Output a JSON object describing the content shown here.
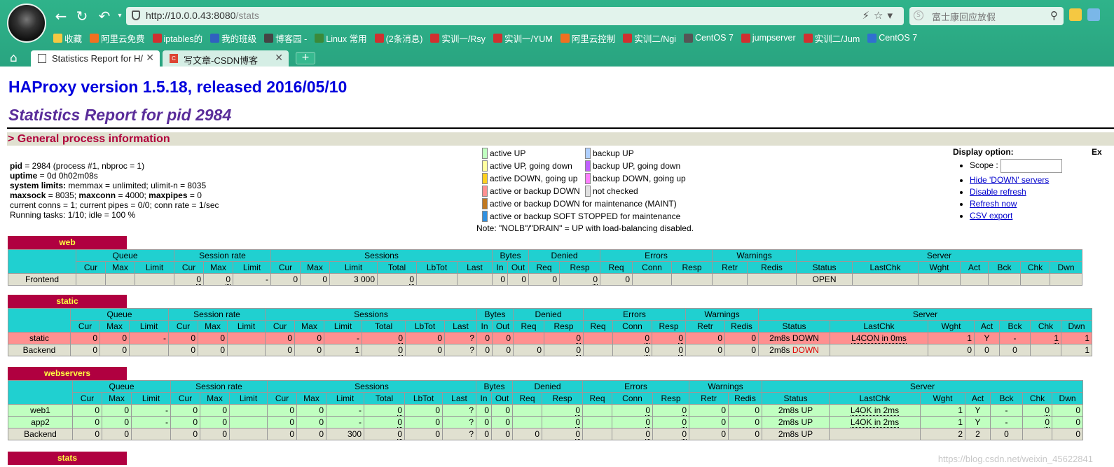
{
  "browser": {
    "url_host": "http://10.0.0.43:8080",
    "url_path": "/stats",
    "search_placeholder": "富士康回应放假",
    "bookmarks": [
      "收藏",
      "阿里云免费",
      "iptables的",
      "我的班级",
      "博客园 -",
      "Linux 常用",
      "(2条消息)",
      "实训一/Rsy",
      "实训一/YUM",
      "阿里云控制",
      "实训二/Ngi",
      "CentOS 7",
      "jumpserver",
      "实训二/Jum",
      "CentOS 7"
    ],
    "tabs": [
      {
        "label": "Statistics Report for H/",
        "active": true
      },
      {
        "label": "写文章-CSDN博客",
        "active": false
      }
    ]
  },
  "page": {
    "title": "HAProxy version 1.5.18, released 2016/05/10",
    "subtitle": "Statistics Report for pid 2984",
    "section": "> General process information",
    "info": {
      "pid_label": "pid",
      "pid_value": " = 2984 (process #1, nbproc = 1)",
      "uptime_label": "uptime",
      "uptime_value": " = 0d 0h02m08s",
      "limits_label": "system limits:",
      "limits_value": " memmax = unlimited; ulimit-n = 8035",
      "maxsock_label": "maxsock",
      "maxsock_value": " = 8035; ",
      "maxconn_label": "maxconn",
      "maxconn_value": " = 4000; ",
      "maxpipes_label": "maxpipes",
      "maxpipes_value": " = 0",
      "conns": "current conns = 1; current pipes = 0/0; conn rate = 1/sec",
      "tasks": "Running tasks: 1/10; idle = 100 %"
    },
    "legend": {
      "active_up": "active UP",
      "active_up_going_down": "active UP, going down",
      "active_down_going_up": "active DOWN, going up",
      "active_or_backup_down": "active or backup DOWN",
      "maint": "active or backup DOWN for maintenance (MAINT)",
      "soft_stopped": "active or backup SOFT STOPPED for maintenance",
      "backup_up": "backup UP",
      "backup_up_going_down": "backup UP, going down",
      "backup_down_going_up": "backup DOWN, going up",
      "not_checked": "not checked",
      "note": "Note: \"NOLB\"/\"DRAIN\" = UP with load-balancing disabled."
    },
    "display": {
      "title": "Display option:",
      "scope": "Scope :",
      "hide_down": "Hide 'DOWN' servers",
      "disable_refresh": "Disable refresh",
      "refresh_now": "Refresh now",
      "csv_export": "CSV export",
      "ex": "Ex"
    },
    "watermark": "https://blog.csdn.net/weixin_45622841"
  },
  "headers": {
    "groups": [
      "Queue",
      "Session rate",
      "Sessions",
      "Bytes",
      "Denied",
      "Errors",
      "Warnings",
      "Server"
    ],
    "cols": [
      "Cur",
      "Max",
      "Limit",
      "Cur",
      "Max",
      "Limit",
      "Cur",
      "Max",
      "Limit",
      "Total",
      "LbTot",
      "Last",
      "In",
      "Out",
      "Req",
      "Resp",
      "Req",
      "Conn",
      "Resp",
      "Retr",
      "Redis",
      "Status",
      "LastChk",
      "Wght",
      "Act",
      "Bck",
      "Chk",
      "Dwn"
    ]
  },
  "proxies": [
    {
      "name": "web",
      "rows": [
        {
          "cls": "frontend",
          "cells": [
            "Frontend",
            "",
            "",
            "",
            "0",
            "0",
            "-",
            "0",
            "0",
            "3 000",
            "0",
            "",
            "",
            "0",
            "0",
            "0",
            "0",
            "0",
            "",
            "",
            "",
            "",
            "OPEN",
            "",
            "",
            "",
            "",
            "",
            ""
          ]
        }
      ]
    },
    {
      "name": "static",
      "rows": [
        {
          "cls": "down",
          "cells": [
            "static",
            "0",
            "0",
            "-",
            "0",
            "0",
            "",
            "0",
            "0",
            "-",
            "0",
            "0",
            "?",
            "0",
            "0",
            "",
            "0",
            "",
            "0",
            "0",
            "0",
            "0",
            "2m8s DOWN",
            "L4CON in 0ms",
            "1",
            "Y",
            "-",
            "1",
            "1"
          ]
        },
        {
          "cls": "backend",
          "cells": [
            "Backend",
            "0",
            "0",
            "",
            "0",
            "0",
            "",
            "0",
            "0",
            "1",
            "0",
            "0",
            "?",
            "0",
            "0",
            "0",
            "0",
            "",
            "0",
            "0",
            "0",
            "0",
            "2m8s DOWN",
            "",
            "0",
            "0",
            "0",
            "",
            "1"
          ]
        }
      ]
    },
    {
      "name": "webservers",
      "rows": [
        {
          "cls": "up",
          "cells": [
            "web1",
            "0",
            "0",
            "-",
            "0",
            "0",
            "",
            "0",
            "0",
            "-",
            "0",
            "0",
            "?",
            "0",
            "0",
            "",
            "0",
            "",
            "0",
            "0",
            "0",
            "0",
            "2m8s UP",
            "L4OK in 2ms",
            "1",
            "Y",
            "-",
            "0",
            "0"
          ]
        },
        {
          "cls": "up",
          "cells": [
            "app2",
            "0",
            "0",
            "-",
            "0",
            "0",
            "",
            "0",
            "0",
            "-",
            "0",
            "0",
            "?",
            "0",
            "0",
            "",
            "0",
            "",
            "0",
            "0",
            "0",
            "0",
            "2m8s UP",
            "L4OK in 2ms",
            "1",
            "Y",
            "-",
            "0",
            "0"
          ]
        },
        {
          "cls": "backend",
          "cells": [
            "Backend",
            "0",
            "0",
            "",
            "0",
            "0",
            "",
            "0",
            "0",
            "300",
            "0",
            "0",
            "?",
            "0",
            "0",
            "0",
            "0",
            "",
            "0",
            "0",
            "0",
            "0",
            "2m8s UP",
            "",
            "2",
            "2",
            "0",
            "",
            "0"
          ]
        }
      ]
    },
    {
      "name": "stats",
      "rows": []
    }
  ],
  "colors": {
    "chrome": "#2fb38a",
    "title": "#0000dd",
    "subtitle": "#5a2d9a",
    "pxname_bg": "#b00040",
    "header_bg": "#20d0d0",
    "down_row": "#ff9090",
    "up_row": "#c0ffc0"
  }
}
